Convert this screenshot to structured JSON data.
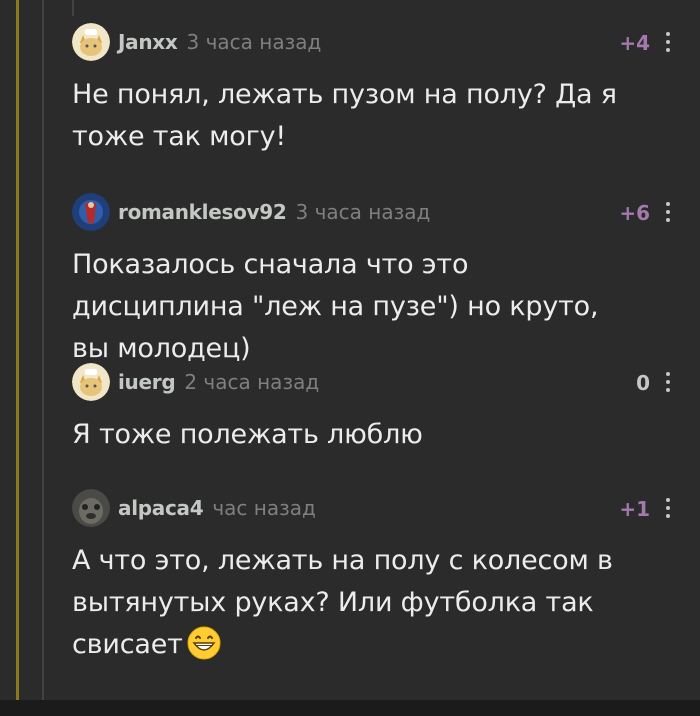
{
  "comments": [
    {
      "author": "Janxx",
      "time": "3 часа назад",
      "rating": "+4",
      "text": "Не понял, лежать пузом на полу? Да я тоже так могу!",
      "avatar": "default-cat-avatar"
    },
    {
      "author": "romanklesov92",
      "time": "3 часа назад",
      "rating": "+6",
      "text": "Показалось сначала что это дисциплина \"леж на пузе\") но круто, вы молодец)",
      "avatar": "photo-avatar"
    },
    {
      "author": "iuerg",
      "time": "2 часа назад",
      "rating": "0",
      "text": "Я тоже полежать люблю",
      "avatar": "default-cat-avatar"
    },
    {
      "author": "alpaca4",
      "time": "час назад",
      "rating": "+1",
      "text": "А что это, лежать на полу с колесом в вытянутых руках? Или футболка так свисает",
      "emoji": "grinning-face-emoji",
      "avatar": "photo-avatar"
    }
  ],
  "colors": {
    "background": "#2a2b2a",
    "positive_rating": "#a479ae",
    "thread_accent": "#8a7a1f"
  }
}
